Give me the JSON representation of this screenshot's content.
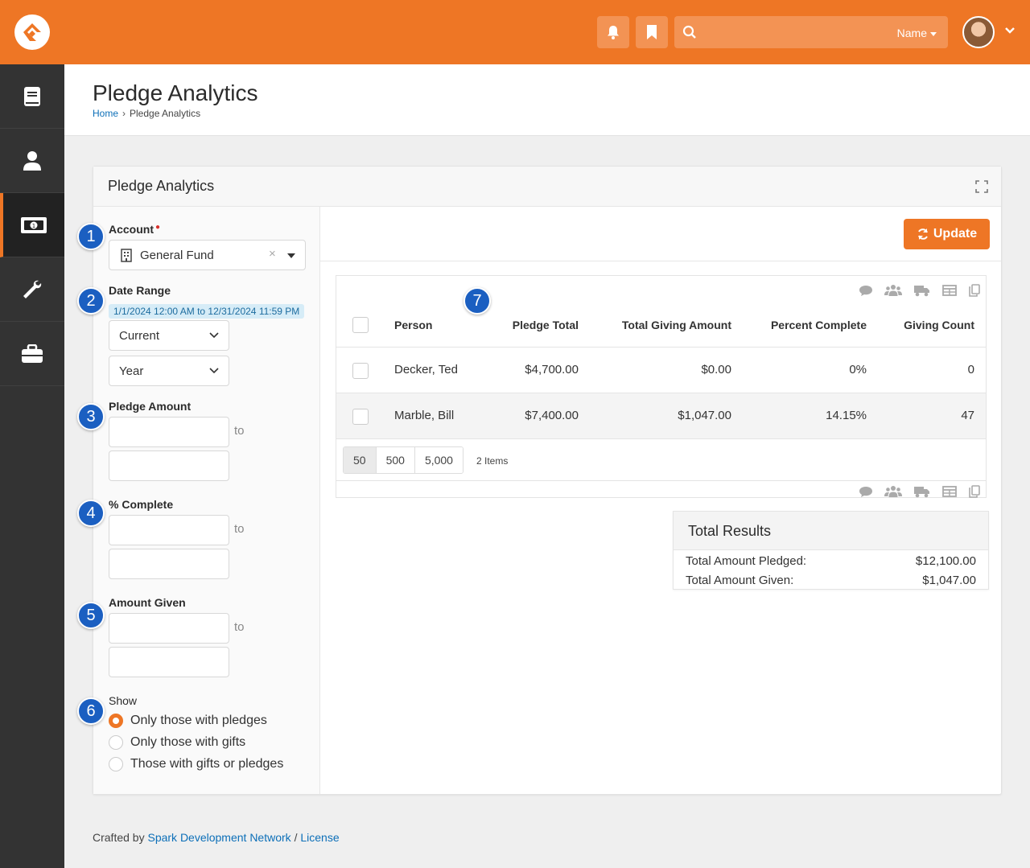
{
  "header": {
    "search_scope": "Name"
  },
  "sidebar": {
    "items": [
      {
        "icon": "book-icon"
      },
      {
        "icon": "person-icon"
      },
      {
        "icon": "money-icon",
        "active": true
      },
      {
        "icon": "wrench-icon"
      },
      {
        "icon": "briefcase-icon"
      }
    ]
  },
  "page": {
    "title": "Pledge Analytics",
    "breadcrumb": {
      "home": "Home",
      "current": "Pledge Analytics"
    }
  },
  "panel": {
    "title": "Pledge Analytics",
    "update_label": "Update"
  },
  "filters": {
    "account": {
      "label": "Account",
      "value": "General Fund"
    },
    "date_range": {
      "label": "Date Range",
      "summary": "1/1/2024 12:00 AM to 12/31/2024 11:59 PM",
      "period": "Current",
      "unit": "Year"
    },
    "pledge_amount": {
      "label": "Pledge Amount",
      "to": "to"
    },
    "percent_complete": {
      "label": "% Complete",
      "to": "to"
    },
    "amount_given": {
      "label": "Amount Given",
      "to": "to"
    },
    "show": {
      "label": "Show",
      "options": [
        "Only those with pledges",
        "Only those with gifts",
        "Those with gifts or pledges"
      ],
      "selected": 0
    }
  },
  "callouts": [
    "1",
    "2",
    "3",
    "4",
    "5",
    "6",
    "7"
  ],
  "grid": {
    "columns": [
      "Person",
      "Pledge Total",
      "Total Giving Amount",
      "Percent Complete",
      "Giving Count"
    ],
    "rows": [
      {
        "person": "Decker, Ted",
        "pledge_total": "$4,700.00",
        "giving_amount": "$0.00",
        "percent": "0%",
        "count": "0"
      },
      {
        "person": "Marble, Bill",
        "pledge_total": "$7,400.00",
        "giving_amount": "$1,047.00",
        "percent": "14.15%",
        "count": "47"
      }
    ],
    "page_sizes": [
      "50",
      "500",
      "5,000"
    ],
    "item_count": "2 Items"
  },
  "totals": {
    "title": "Total Results",
    "pledged_label": "Total Amount Pledged:",
    "pledged_value": "$12,100.00",
    "given_label": "Total Amount Given:",
    "given_value": "$1,047.00"
  },
  "footer": {
    "prefix": "Crafted by",
    "org": "Spark Development Network",
    "sep": "/",
    "license": "License"
  },
  "colors": {
    "brand": "#ee7625",
    "sidebar": "#333333",
    "link": "#0c6fb8",
    "callout": "#1b5fc1"
  }
}
